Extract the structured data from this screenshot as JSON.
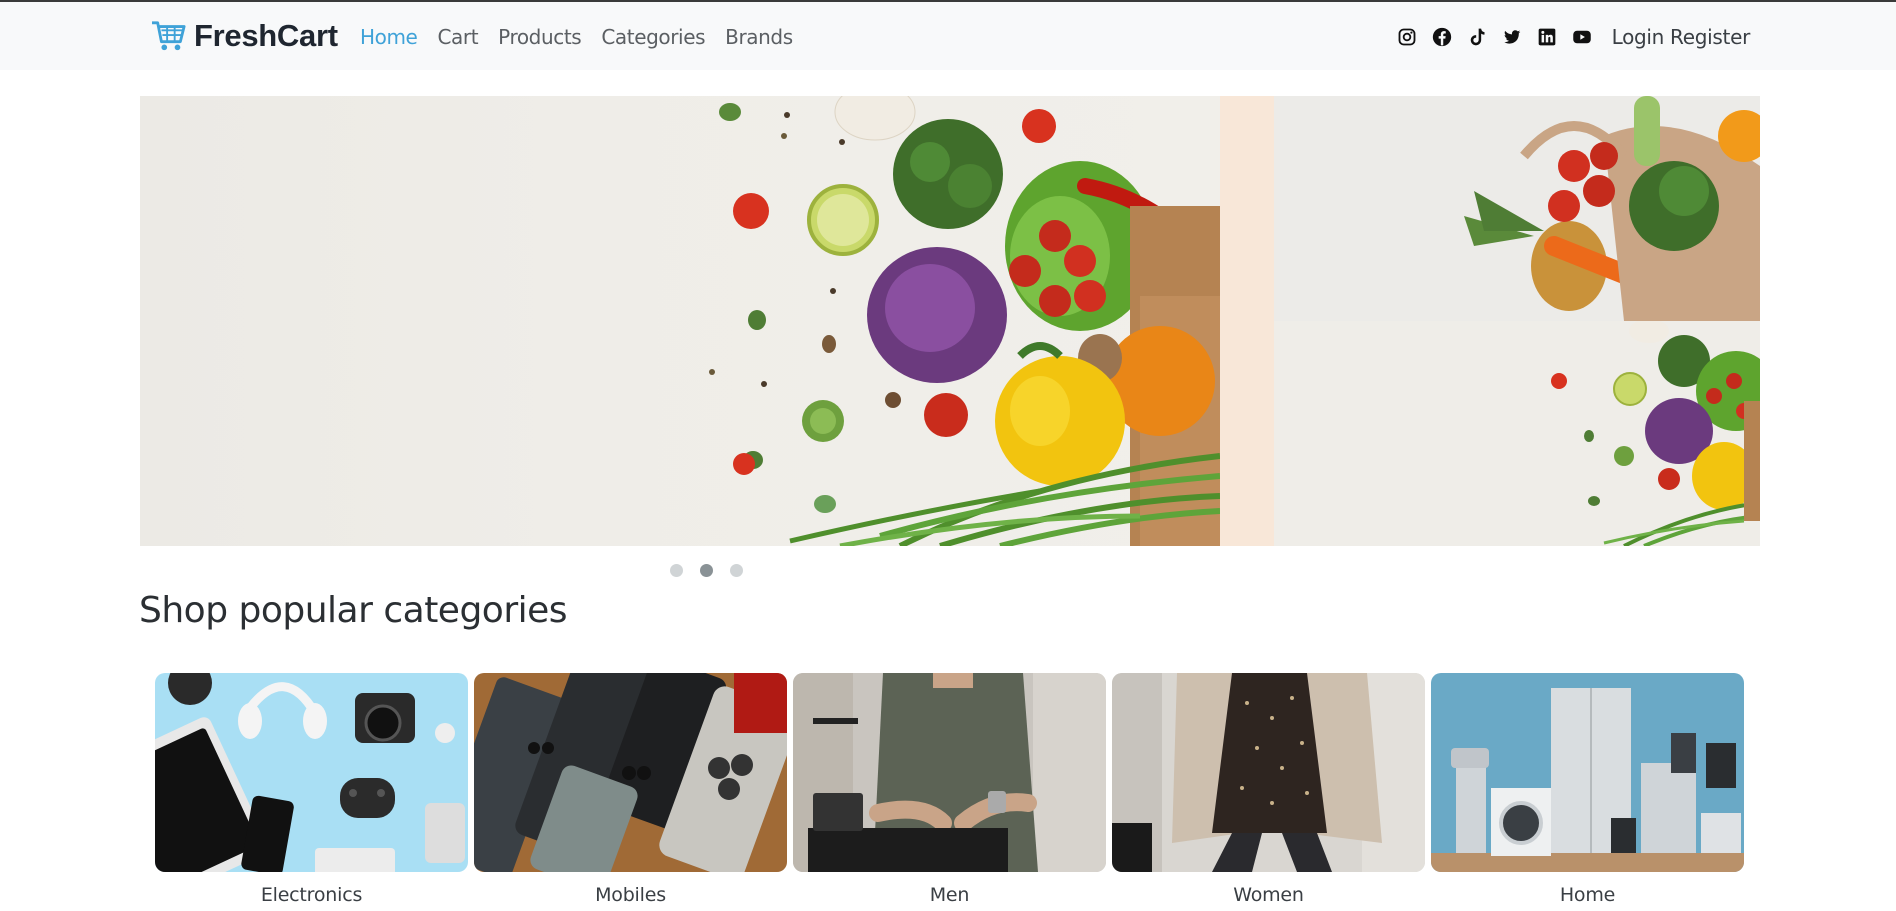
{
  "brand": {
    "name": "FreshCart",
    "color": "#1f2630",
    "icon_color": "#3fa2d8"
  },
  "nav": {
    "links": [
      {
        "label": "Home",
        "active": true
      },
      {
        "label": "Cart",
        "active": false
      },
      {
        "label": "Products",
        "active": false
      },
      {
        "label": "Categories",
        "active": false
      },
      {
        "label": "Brands",
        "active": false
      }
    ],
    "active_color": "#3fa2d8"
  },
  "social": [
    "instagram-icon",
    "facebook-icon",
    "tiktok-icon",
    "twitter-icon",
    "linkedin-icon",
    "youtube-icon"
  ],
  "auth": {
    "login": "Login",
    "register": "Register"
  },
  "slider": {
    "active_index": 1,
    "dots": 3,
    "images": [
      "vegetables-grocery-bag",
      "grocery-bag-fruits",
      "vegetables-spread"
    ]
  },
  "section": {
    "title": "Shop popular categories"
  },
  "categories": [
    {
      "name": "Electronics"
    },
    {
      "name": "Mobiles"
    },
    {
      "name": "Men"
    },
    {
      "name": "Women"
    },
    {
      "name": "Home"
    }
  ]
}
